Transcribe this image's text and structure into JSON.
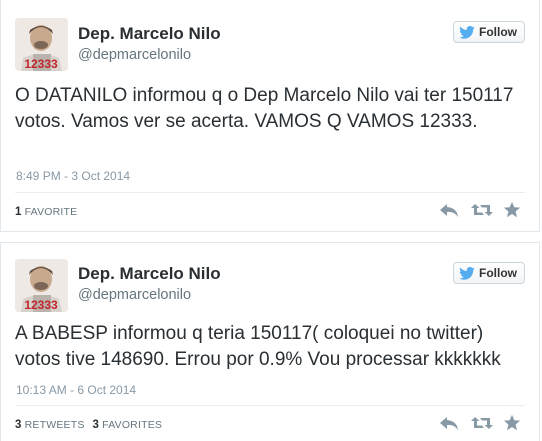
{
  "tweets": [
    {
      "author": {
        "display_name": "Dep. Marcelo Nilo",
        "handle": "@depmarcelonilo",
        "avatar_badge": "12333"
      },
      "follow_label": "Follow",
      "text": "O DATANILO  informou q o Dep Marcelo Nilo vai ter 150117 votos. Vamos ver se acerta. VAMOS Q VAMOS 12333.",
      "timestamp": "8:49 PM - 3 Oct 2014",
      "retweets": {
        "count": "",
        "label": ""
      },
      "favorites": {
        "count": "1",
        "label": "FAVORITE"
      }
    },
    {
      "author": {
        "display_name": "Dep. Marcelo Nilo",
        "handle": "@depmarcelonilo",
        "avatar_badge": "12333"
      },
      "follow_label": "Follow",
      "text": "A BABESP informou q teria 150117( coloquei no twitter) votos tive 148690. Errou por 0.9% Vou processar  kkkkkkk",
      "timestamp": "10:13 AM - 6 Oct 2014",
      "retweets": {
        "count": "3",
        "label": "RETWEETS"
      },
      "favorites": {
        "count": "3",
        "label": "FAVORITES"
      }
    }
  ],
  "colors": {
    "text": "#292f33",
    "muted": "#8899a6",
    "twitter_blue": "#55acee",
    "badge_red": "#c1272d",
    "action_gray": "#8899a6"
  },
  "icons": [
    "twitter-bird-icon",
    "reply-icon",
    "retweet-icon",
    "favorite-star-icon"
  ]
}
